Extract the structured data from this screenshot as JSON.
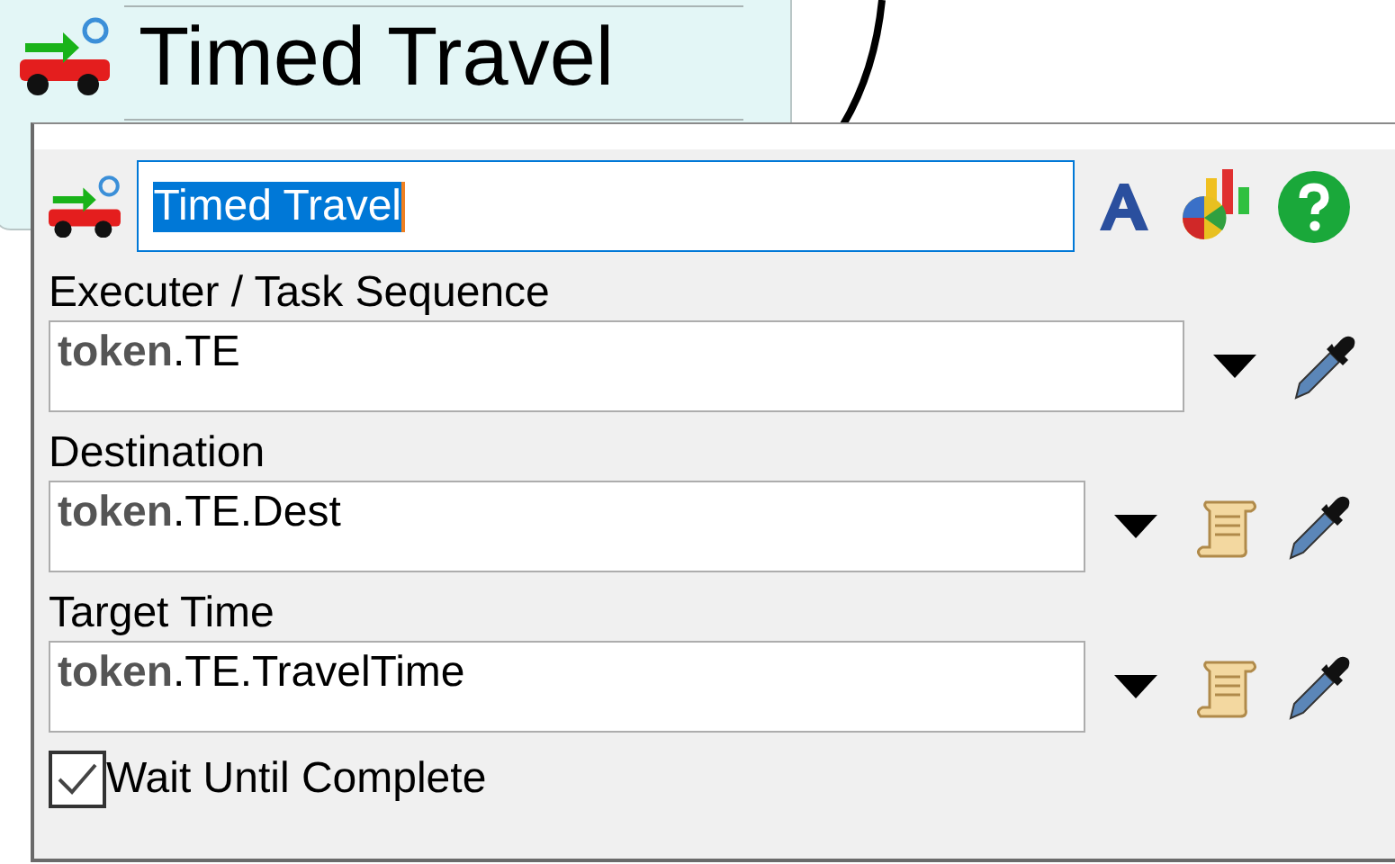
{
  "node": {
    "title": "Timed Travel"
  },
  "popup": {
    "name": {
      "value": "Timed Travel",
      "selected": true
    },
    "fields": [
      {
        "label": "Executer / Task Sequence",
        "value": "**token**.TE",
        "code_editor": false
      },
      {
        "label": "Destination",
        "value": "**token**.TE.Dest",
        "code_editor": true
      },
      {
        "label": "Target Time",
        "value": "**token**.TE.TravelTime",
        "code_editor": true
      }
    ],
    "wait_until_complete": {
      "label": "Wait Until Complete",
      "checked": true
    }
  }
}
